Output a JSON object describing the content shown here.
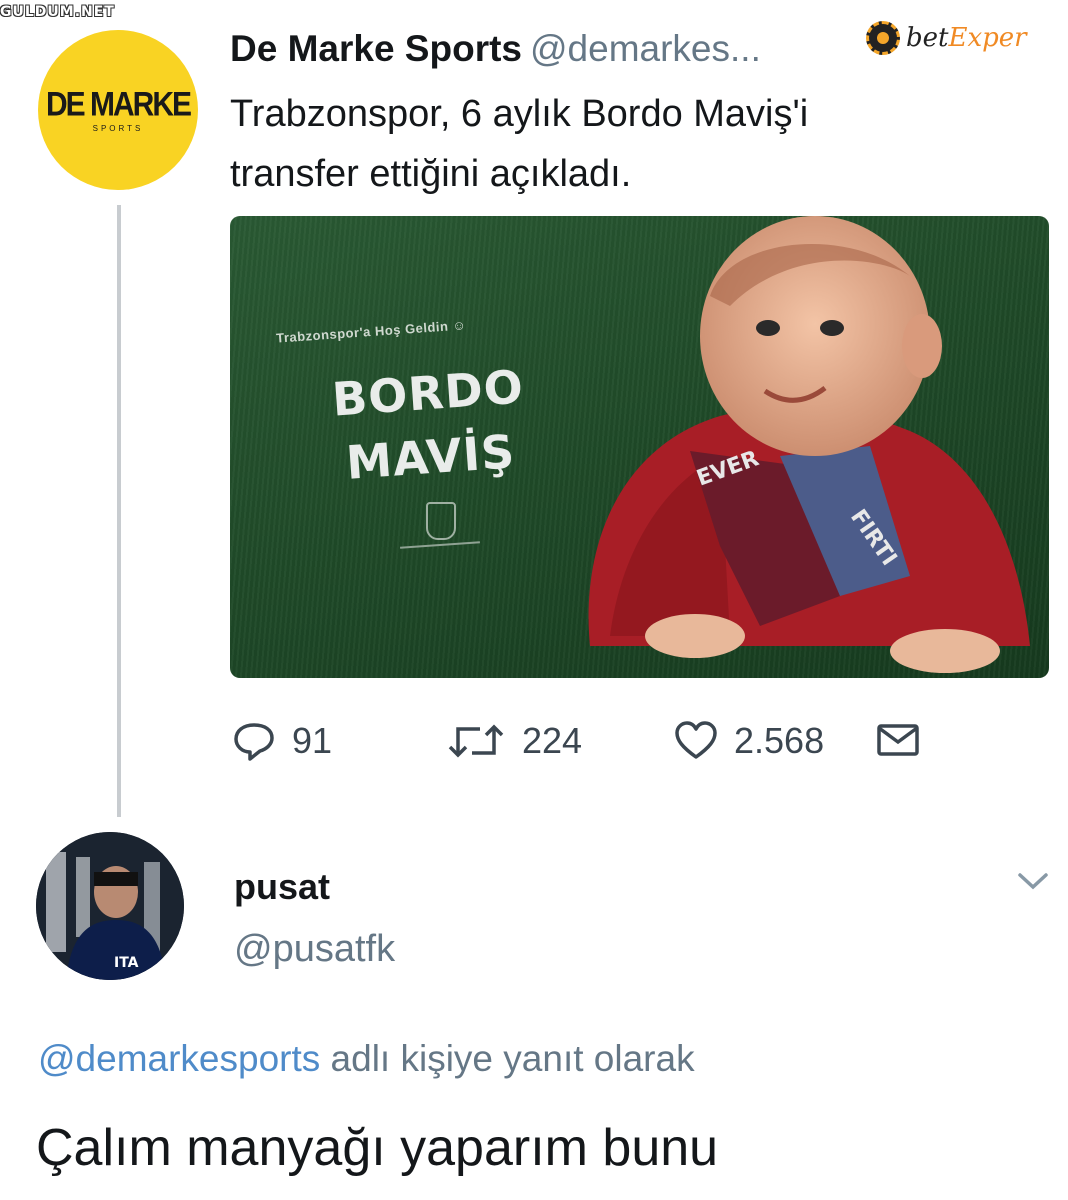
{
  "watermark": "GULDUM.NET",
  "sponsor": {
    "prefix": "bet",
    "suffix": "Exper"
  },
  "tweet": {
    "avatar_brand": "DE MARKE",
    "avatar_sub": "SPORTS",
    "display_name": "De Marke Sports",
    "handle": "@demarkes...",
    "text_line1": "Trabzonspor, 6 aylık Bordo Maviş'i",
    "text_line2": "transfer ettiğini açıkladı.",
    "media": {
      "caption": "Trabzonspor'a Hoş Geldin ☺",
      "title_line1": "BORDO",
      "title_line2": "MAVİŞ"
    },
    "stats": {
      "replies": "91",
      "retweets": "224",
      "likes": "2.568"
    }
  },
  "reply": {
    "display_name": "pusat",
    "handle": "@pusatfk",
    "replying_mention": "@demarkesports",
    "replying_suffix": " adlı kişiye yanıt olarak",
    "text": "Çalım manyağı yaparım bunu"
  },
  "colors": {
    "accent_blue": "#4f8bc9",
    "muted": "#657786",
    "brand_yellow": "#f9d323",
    "pitch_green": "#1f4a28"
  }
}
